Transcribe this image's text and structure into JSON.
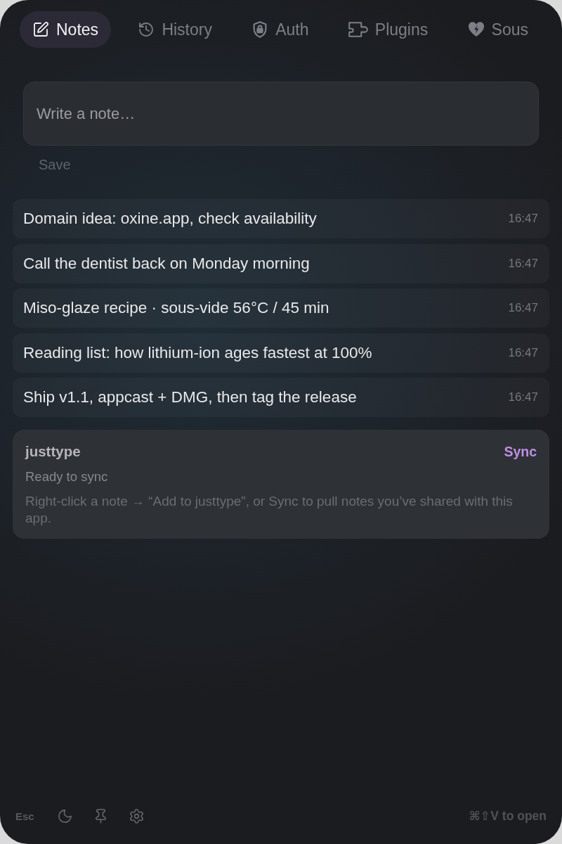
{
  "tabs": [
    {
      "label": "Notes",
      "selected": true
    },
    {
      "label": "History",
      "selected": false
    },
    {
      "label": "Auth",
      "selected": false
    },
    {
      "label": "Plugins",
      "selected": false
    },
    {
      "label": "Sous",
      "selected": false
    }
  ],
  "composer": {
    "placeholder": "Write a note…",
    "save_label": "Save",
    "save_disabled": true
  },
  "notes": [
    {
      "text": "Domain idea: oxine.app, check availability",
      "time": "16:47"
    },
    {
      "text": "Call the dentist back on Monday morning",
      "time": "16:47"
    },
    {
      "text": "Miso-glaze recipe · sous-vide 56°C / 45 min",
      "time": "16:47"
    },
    {
      "text": "Reading list: how lithium-ion ages fastest at 100%",
      "time": "16:47"
    },
    {
      "text": "Ship v1.1, appcast + DMG, then tag the release",
      "time": "16:47"
    }
  ],
  "sync_panel": {
    "title": "justtype",
    "action": "Sync",
    "status": "Ready to sync",
    "hint": "Right-click a note → “Add to justtype”, or Sync to pull notes you’ve shared with this app."
  },
  "footer": {
    "esc": "Esc",
    "shortcut": "⌘⇧V to open"
  }
}
